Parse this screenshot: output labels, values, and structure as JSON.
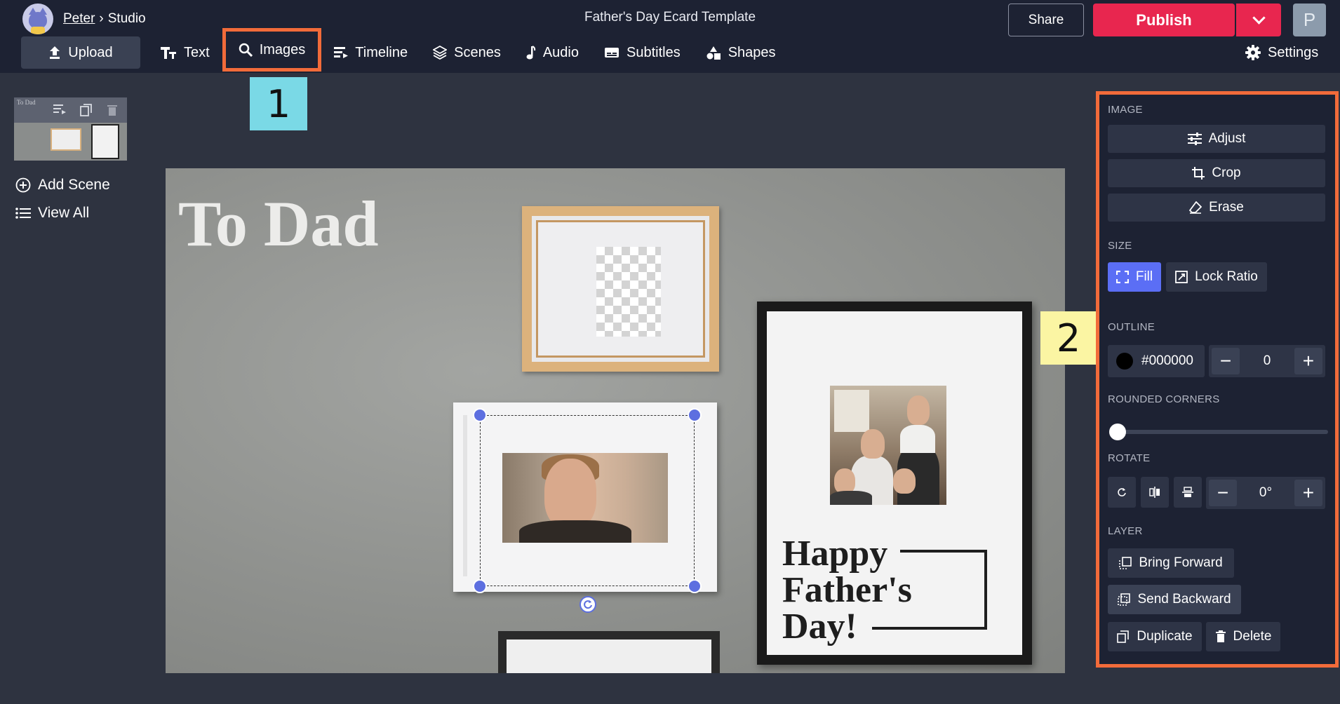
{
  "header": {
    "user": "Peter",
    "separator": "›",
    "section": "Studio",
    "doc_title": "Father's Day Ecard Template",
    "share_label": "Share",
    "publish_label": "Publish",
    "profile_initial": "P"
  },
  "toolbar": {
    "items": [
      {
        "label": "Upload",
        "icon": "upload-icon"
      },
      {
        "label": "Text",
        "icon": "text-icon"
      },
      {
        "label": "Images",
        "icon": "search-icon"
      },
      {
        "label": "Timeline",
        "icon": "timeline-icon"
      },
      {
        "label": "Scenes",
        "icon": "layers-icon"
      },
      {
        "label": "Audio",
        "icon": "music-note-icon"
      },
      {
        "label": "Subtitles",
        "icon": "subtitles-icon"
      },
      {
        "label": "Shapes",
        "icon": "shapes-icon"
      }
    ],
    "settings_label": "Settings"
  },
  "callouts": {
    "one": "1",
    "two": "2"
  },
  "sidebar": {
    "thumb_title": "To Dad",
    "add_scene": "Add Scene",
    "view_all": "View All"
  },
  "canvas": {
    "title": "To Dad",
    "card_line1": "Happy",
    "card_line2": "Father's",
    "card_line3": "Day!"
  },
  "panel": {
    "image_label": "IMAGE",
    "adjust": "Adjust",
    "crop": "Crop",
    "erase": "Erase",
    "size_label": "SIZE",
    "fill": "Fill",
    "lock_ratio": "Lock Ratio",
    "outline_label": "OUTLINE",
    "outline_color": "#000000",
    "outline_width": "0",
    "rounded_label": "ROUNDED CORNERS",
    "rounded_value": 0,
    "rotate_label": "ROTATE",
    "rotate_value": "0°",
    "layer_label": "LAYER",
    "bring_forward": "Bring Forward",
    "send_backward": "Send Backward",
    "duplicate": "Duplicate",
    "delete": "Delete"
  },
  "colors": {
    "topbar": "#1d2233",
    "publish": "#e8264f",
    "accent": "#5b6ef5",
    "highlight": "#f26b3a",
    "callout1": "#7ad9e6",
    "callout2": "#fbf5a3"
  }
}
